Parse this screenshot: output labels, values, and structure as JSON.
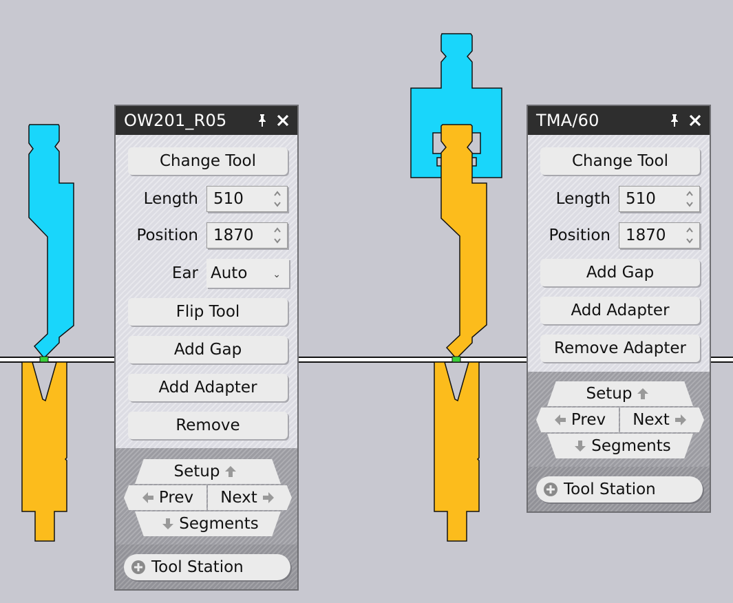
{
  "panels": [
    {
      "id": "left",
      "title": "OW201_R05",
      "pin_icon": "pin-icon",
      "close_icon": "close-icon",
      "change_tool_label": "Change Tool",
      "length": {
        "label": "Length",
        "value": "510"
      },
      "position": {
        "label": "Position",
        "value": "1870"
      },
      "ear": {
        "label": "Ear",
        "value": "Auto"
      },
      "actions": [
        "Flip Tool",
        "Add Gap",
        "Add Adapter",
        "Remove"
      ],
      "nav": {
        "setup": "Setup",
        "prev": "Prev",
        "next": "Next",
        "segments": "Segments"
      },
      "tool_station_label": "Tool Station"
    },
    {
      "id": "right",
      "title": "TMA/60",
      "pin_icon": "pin-icon",
      "close_icon": "close-icon",
      "change_tool_label": "Change Tool",
      "length": {
        "label": "Length",
        "value": "510"
      },
      "position": {
        "label": "Position",
        "value": "1870"
      },
      "actions": [
        "Add Gap",
        "Add Adapter",
        "Remove Adapter"
      ],
      "nav": {
        "setup": "Setup",
        "prev": "Prev",
        "next": "Next",
        "segments": "Segments"
      },
      "tool_station_label": "Tool Station"
    }
  ],
  "colors": {
    "background": "#c8c8d0",
    "punch": "#19d6fb",
    "die": "#fcbc1c",
    "adapter": "#19d6fb",
    "contact_marker": "#3ad13a",
    "panel_header": "#2e2e2e"
  },
  "tools": [
    {
      "name": "punch-OW201_R05",
      "type": "punch"
    },
    {
      "name": "die-left",
      "type": "die"
    },
    {
      "name": "adapter",
      "type": "adapter"
    },
    {
      "name": "punch-TMA/60",
      "type": "punch"
    },
    {
      "name": "die-right",
      "type": "die"
    }
  ]
}
